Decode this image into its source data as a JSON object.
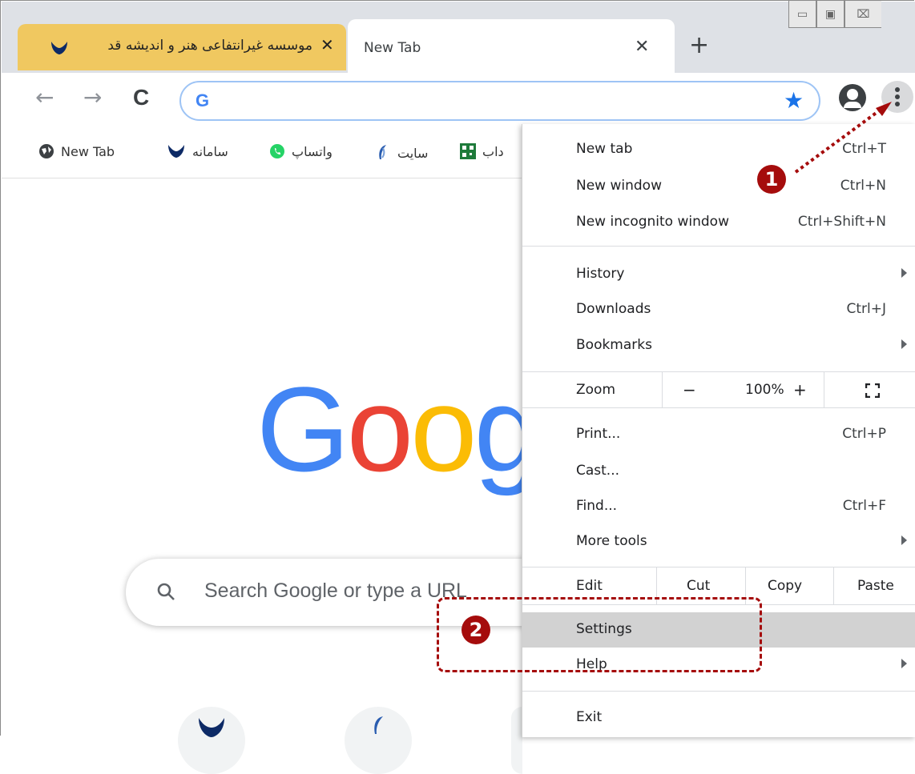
{
  "tabs": {
    "inactive": {
      "title": "موسسه غیرانتفاعی هنر و اندیشه قد",
      "close": "✕"
    },
    "active": {
      "title": "New Tab",
      "close": "✕"
    },
    "new_tab_glyph": "+"
  },
  "window_controls": {
    "minimize": "▭",
    "maximize": "▣",
    "close": "⌧"
  },
  "toolbar": {
    "back": "←",
    "forward": "→",
    "reload": "C",
    "omnibox_icon": "G",
    "star": "★"
  },
  "bookmarks": [
    {
      "label": "New Tab",
      "icon": "globe-icon"
    },
    {
      "label": "سامانه",
      "icon": "logo-icon"
    },
    {
      "label": "واتساپ",
      "icon": "whatsapp-icon"
    },
    {
      "label": "سایت",
      "icon": "feather-icon"
    },
    {
      "label": "داب",
      "icon": "qr-icon"
    }
  ],
  "google_logo": {
    "text": "Goog"
  },
  "search": {
    "placeholder": "Search Google or type a URL"
  },
  "menu": {
    "new_tab": {
      "label": "New tab",
      "shortcut": "Ctrl+T"
    },
    "new_window": {
      "label": "New window",
      "shortcut": "Ctrl+N"
    },
    "new_incognito": {
      "label": "New incognito window",
      "shortcut": "Ctrl+Shift+N"
    },
    "history": {
      "label": "History"
    },
    "downloads": {
      "label": "Downloads",
      "shortcut": "Ctrl+J"
    },
    "bookmarks": {
      "label": "Bookmarks"
    },
    "zoom": {
      "label": "Zoom",
      "minus": "−",
      "value": "100%",
      "plus": "+"
    },
    "print": {
      "label": "Print...",
      "shortcut": "Ctrl+P"
    },
    "cast": {
      "label": "Cast..."
    },
    "find": {
      "label": "Find...",
      "shortcut": "Ctrl+F"
    },
    "more_tools": {
      "label": "More tools"
    },
    "edit": {
      "label": "Edit",
      "cut": "Cut",
      "copy": "Copy",
      "paste": "Paste"
    },
    "settings": {
      "label": "Settings"
    },
    "help": {
      "label": "Help"
    },
    "exit": {
      "label": "Exit"
    }
  },
  "annotations": {
    "step1": "1",
    "step2": "2",
    "color": "#a50c0c"
  }
}
